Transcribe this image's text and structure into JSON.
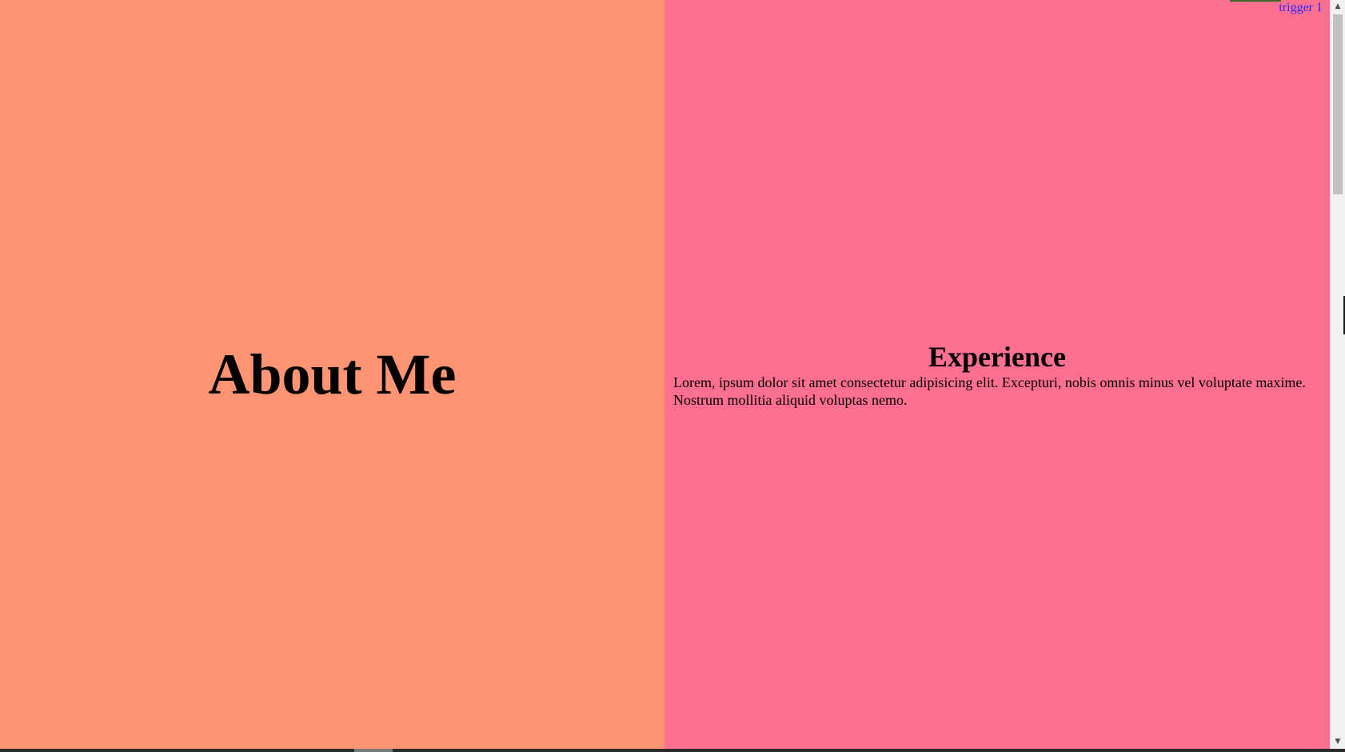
{
  "left_panel": {
    "title": "About Me",
    "background": "#ff9473"
  },
  "right_panel": {
    "title": "Experience",
    "body": "Lorem, ipsum dolor sit amet consectetur adipisicing elit. Excepturi, nobis omnis minus vel voluptate maxime. Nostrum mollitia aliquid voluptas nemo.",
    "background": "#ff6f8f"
  },
  "trigger": {
    "label": "trigger 1",
    "color": "#2b2bff"
  },
  "scrollbar": {
    "up_icon": "▲",
    "down_icon": "▼"
  }
}
